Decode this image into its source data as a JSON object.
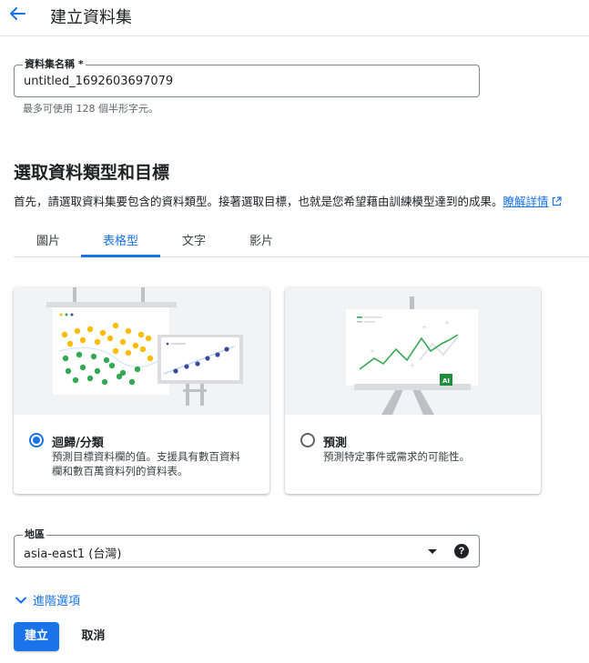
{
  "header": {
    "title": "建立資料集"
  },
  "dataset_name": {
    "label": "資料集名稱 *",
    "value": "untitled_1692603697079",
    "hint": "最多可使用 128 個半形字元。"
  },
  "section": {
    "title": "選取資料類型和目標",
    "description": "首先，請選取資料集要包含的資料類型。接著選取目標，也就是您希望藉由訓練模型達到的成果。",
    "learn_more": "瞭解詳情"
  },
  "tabs": [
    {
      "label": "圖片"
    },
    {
      "label": "表格型",
      "active": true
    },
    {
      "label": "文字"
    },
    {
      "label": "影片"
    }
  ],
  "objectives": [
    {
      "title": "迴歸/分類",
      "description_line1": "預測目標資料欄的值。支援具有數百資料",
      "description_line2": "欄和數百萬資料列的資料表。",
      "selected": true
    },
    {
      "title": "預測",
      "description_line1": "預測特定事件或需求的可能性。",
      "selected": false
    }
  ],
  "region": {
    "label": "地區",
    "value": "asia-east1 (台灣)"
  },
  "advanced_options": {
    "label": "進階選項"
  },
  "actions": {
    "create": "建立",
    "cancel": "取消"
  },
  "illustration_badge": "AI",
  "colors": {
    "accent": "#1a73e8",
    "yellow": "#fbbc04",
    "green": "#34a853",
    "navy": "#3c4a9a"
  }
}
